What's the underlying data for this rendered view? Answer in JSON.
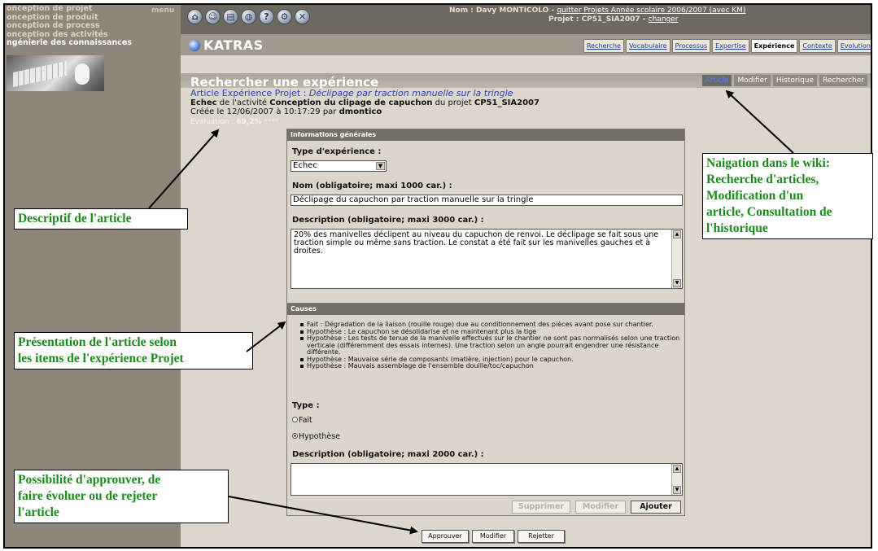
{
  "sidebar": {
    "items": [
      "onception de projet",
      "onception de produit",
      "onception de process",
      "onception des activités",
      "ngénierie des connaissances"
    ],
    "menu_label": "menu"
  },
  "topbar": {
    "icons": [
      "home-icon",
      "user-icon",
      "document-icon",
      "globe-icon",
      "help-icon",
      "settings-icon",
      "tools-icon"
    ],
    "user_prefix": "Nom : Davy MONTICOLO - ",
    "user_link": "quitter Projets Année scolaire 2006/2007 (avec KM)",
    "project_prefix": "Projet : CP51_SIA2007 - ",
    "project_link": "changer"
  },
  "logo": "KATRAS",
  "tabs": [
    "Recherche",
    "Vocabulaire",
    "Processus",
    "Expertise",
    "Expérience",
    "Contexte",
    "Evolution"
  ],
  "active_tab": "Expérience",
  "page": {
    "title": "Rechercher une expérience",
    "article_tabs": [
      "Article",
      "Modifier",
      "Historique",
      "Rechercher"
    ],
    "meta_type": "Article Expérience Projet",
    "meta_title": "Déclipage par traction manuelle sur la tringle",
    "meta_status": "Echec",
    "meta_activity_prefix": "de l'activité",
    "meta_activity": "Conception du clipage de capuchon",
    "meta_project_prefix": "du projet",
    "meta_project": "CP51_SIA2007",
    "meta_created": "Créée le 12/06/2007 à 10:17:29 par",
    "meta_author": "dmontico",
    "evaluation_label": "Evaluation :",
    "evaluation_value": "69,2%",
    "evaluation_stars": "****"
  },
  "general": {
    "header": "Informations générales",
    "type_label": "Type d'expérience :",
    "type_value": "Echec",
    "name_label": "Nom (obligatoire; maxi 1000 car.) :",
    "name_value": "Déclipage du capuchon par traction manuelle sur la tringle",
    "desc_label": "Description (obligatoire; maxi 3000 car.) :",
    "desc_value": "20% des manivelles déclipent au niveau du capuchon de renvoi. Le déclipage se fait sous une traction simple ou même sans traction. Le constat a été fait sur les manivelles gauches et à droites."
  },
  "causes": {
    "header": "Causes",
    "items": [
      "Fait : Dégradation de la liaison (rouille rouge) due au conditionnement des pièces avant pose sur chantier.",
      "Hypothèse : Le capuchon se désolidarise et ne maintenant plus la tige",
      "Hypothèse : Les tests de tenue de la manivelle effectués sur le chantier ne sont pas normalisés selon une traction verticale (différemment des essais internes). Une traction selon un angle pourrait engendrer une résistance différente.",
      "Hypothèse : Mauvaise série de composants (matière, injection) pour le capuchon.",
      "Hypothèse : Mauvais assemblage de l'ensemble douille/toc/capuchon"
    ],
    "type_label": "Type :",
    "options": [
      "Fait",
      "Hypothèse"
    ],
    "selected": "Hypothèse",
    "desc_label": "Description (obligatoire; maxi 2000 car.) :",
    "desc_value": "",
    "buttons": [
      "Supprimer",
      "Modifier",
      "Ajouter"
    ]
  },
  "actions": [
    "Approuver",
    "Modifier",
    "Rejetter"
  ],
  "annotations": {
    "descriptif": "Descriptif de l'article",
    "presentation": [
      "Présentation de l'article selon",
      "les items de l'expérience Projet"
    ],
    "navigation": [
      "Naigation dans le wiki:",
      "Recherche d'articles,",
      "Modification d'un",
      "article, Consultation de",
      "l'historique"
    ],
    "approval": [
      "Possibilité d'approuver, de",
      "faire évoluer ou de rejeter",
      "l'article"
    ]
  },
  "colors": {
    "sidebar_bg": "#8f867a",
    "panel_head": "#757065",
    "annotation_text": "#1b8c1b",
    "link_blue": "#2b3fb0"
  }
}
